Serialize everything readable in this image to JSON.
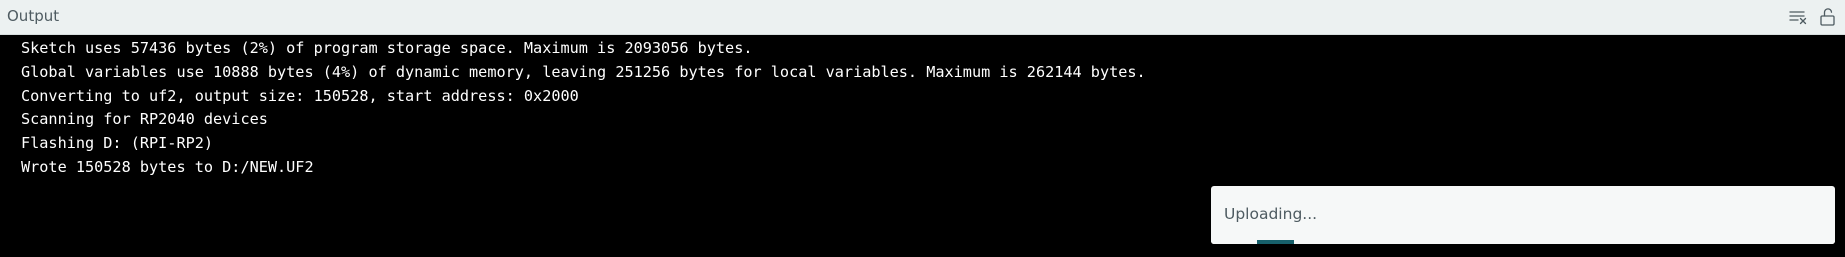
{
  "panel": {
    "title": "Output",
    "clear_icon": "clear-output-icon",
    "lock_icon": "unlock-icon"
  },
  "console": {
    "lines": [
      "Sketch uses 57436 bytes (2%) of program storage space. Maximum is 2093056 bytes.",
      "Global variables use 10888 bytes (4%) of dynamic memory, leaving 251256 bytes for local variables. Maximum is 262144 bytes.",
      "Converting to uf2, output size: 150528, start address: 0x2000",
      "Scanning for RP2040 devices",
      "Flashing D: (RPI-RP2)",
      "Wrote 150528 bytes to D:/NEW.UF2"
    ]
  },
  "notification": {
    "message": "Uploading...",
    "progress": 0.06
  },
  "colors": {
    "header_bg": "#ecf1f1",
    "console_bg": "#000000",
    "console_text": "#ffffff",
    "toast_bg": "#f6f8f8",
    "accent": "#17606b"
  }
}
